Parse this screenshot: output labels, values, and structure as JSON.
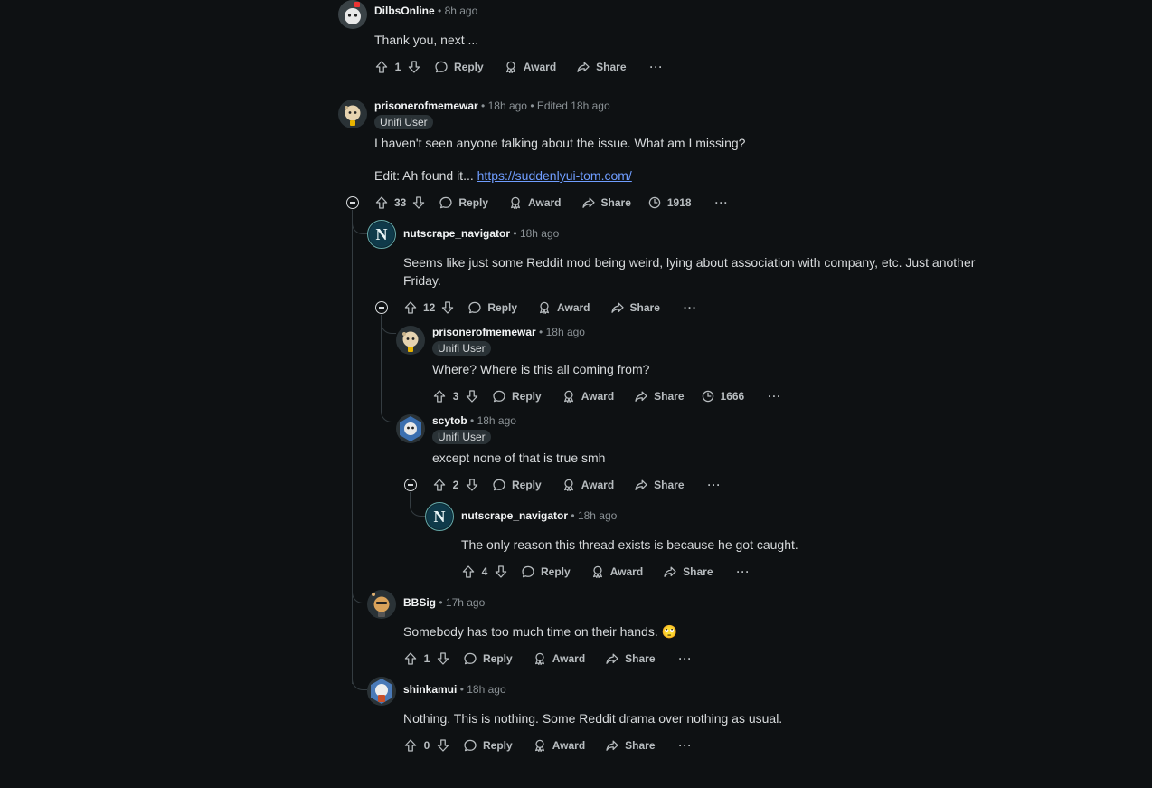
{
  "labels": {
    "reply": "Reply",
    "award": "Award",
    "share": "Share",
    "more": "···",
    "dot": "•"
  },
  "comments": [
    {
      "author": "DilbsOnline",
      "time": "8h ago",
      "body": "Thank you, next ...",
      "votes": "1"
    },
    {
      "author": "prisonerofmemewar",
      "time": "18h ago",
      "edited": "Edited 18h ago",
      "flair": "Unifi User",
      "body": "I haven't seen anyone talking about the issue. What am I missing?",
      "body2_prefix": "Edit: Ah found it... ",
      "link": "https://suddenlyui-tom.com/",
      "votes": "33",
      "views": "1918"
    },
    {
      "author": "nutscrape_navigator",
      "time": "18h ago",
      "body": "Seems like just some Reddit mod being weird, lying about association with company, etc. Just another Friday.",
      "votes": "12"
    },
    {
      "author": "prisonerofmemewar",
      "time": "18h ago",
      "flair": "Unifi User",
      "body": "Where? Where is this all coming from?",
      "votes": "3",
      "views": "1666"
    },
    {
      "author": "scytob",
      "time": "18h ago",
      "flair": "Unifi User",
      "body": "except none of that is true smh",
      "votes": "2"
    },
    {
      "author": "nutscrape_navigator",
      "time": "18h ago",
      "body": "The only reason this thread exists is because he got caught.",
      "votes": "4"
    },
    {
      "author": "BBSig",
      "time": "17h ago",
      "body": "Somebody has too much time on their hands.",
      "emoji": "🙄",
      "votes": "1"
    },
    {
      "author": "shinkamui",
      "time": "18h ago",
      "body": "Nothing. This is nothing. Some Reddit drama over nothing as usual.",
      "votes": "0"
    }
  ]
}
